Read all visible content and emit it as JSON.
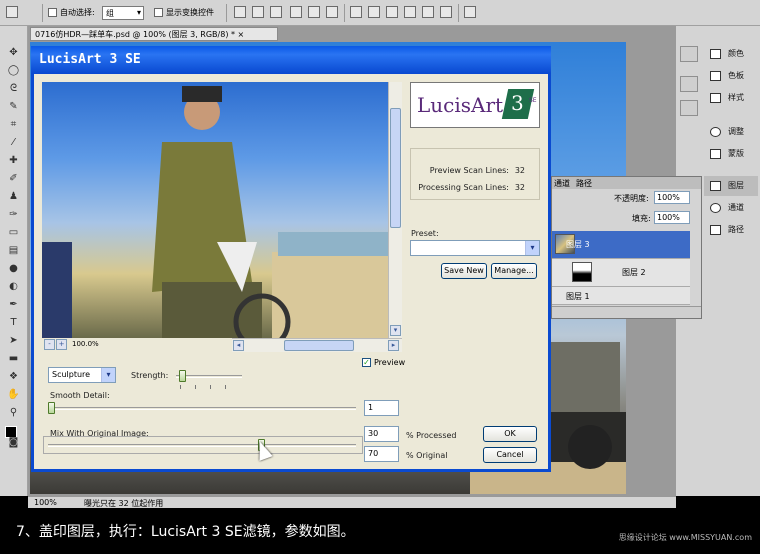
{
  "options_bar": {
    "auto_select_label": "自动选择:",
    "auto_select_value": "组",
    "show_transform_label": "显示变换控件"
  },
  "document": {
    "tab_title": "0716仿HDR—踩单车.psd @ 100% (图层 3, RGB/8) *",
    "close_glyph": "×",
    "zoom_status": "100%",
    "status_text": "曝光只在 32 位起作用"
  },
  "panels": {
    "color": "颜色",
    "swatches": "色板",
    "styles": "样式",
    "adjustments": "调整",
    "masks": "蒙版",
    "layers": "图层",
    "channels": "通道",
    "paths": "路径"
  },
  "layers_panel": {
    "tab_channels": "通道",
    "tab_paths": "路径",
    "opacity_label": "不透明度:",
    "opacity_value": "100%",
    "fill_label": "填充:",
    "fill_value": "100%",
    "layers": [
      "图层 3",
      "图层 2",
      "图层 1"
    ]
  },
  "dialog": {
    "title": "LucisArt 3 SE",
    "logo_text": "LucisArt",
    "logo_number": "3",
    "logo_suffix": "SE",
    "preview_scan_label": "Preview Scan Lines:",
    "preview_scan_value": "32",
    "processing_scan_label": "Processing Scan Lines:",
    "processing_scan_value": "32",
    "preset_label": "Preset:",
    "preset_value": "",
    "save_new": "Save New",
    "manage": "Manage...",
    "zoom_value": "100.0%",
    "zoom_minus": "-",
    "zoom_plus": "+",
    "preview_checkbox": "Preview",
    "effect_value": "Sculpture",
    "strength_label": "Strength:",
    "strength_level": 0.05,
    "smooth_label": "Smooth Detail:",
    "smooth_value": "1",
    "mix_label": "Mix With Original Image:",
    "processed_value": "30",
    "processed_label": "% Processed",
    "original_value": "70",
    "original_label": "% Original",
    "ok": "OK",
    "cancel": "Cancel"
  },
  "caption": {
    "text": "7、盖印图层，执行：LucisArt 3 SE滤镜，参数如图。",
    "watermark": "思缘设计论坛 www.MISSYUAN.com"
  },
  "colors": {
    "xp_blue": "#0a4ad0",
    "dialog_bg": "#ece9d8",
    "selected_layer": "#3d6bc6",
    "logo_purple": "#5a2a7a",
    "logo_green": "#1e6e4a"
  }
}
